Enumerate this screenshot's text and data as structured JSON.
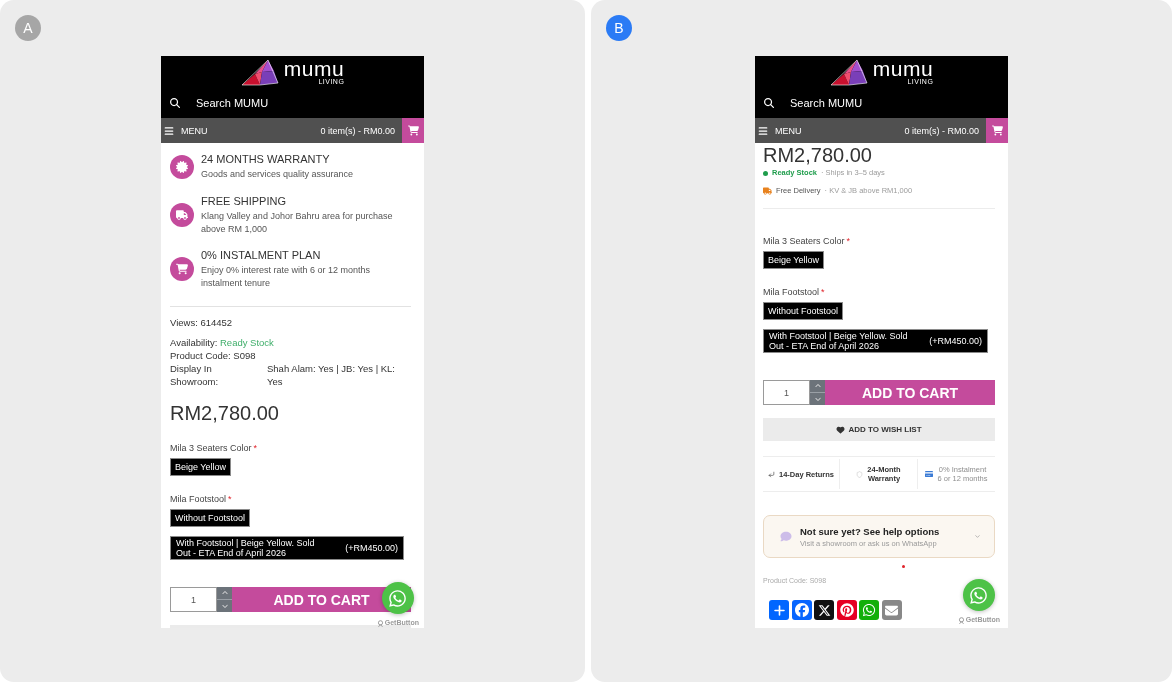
{
  "panels": [
    {
      "badge": "A",
      "color": "#a6a6a6",
      "phone": {
        "logo": {
          "name": "mumu",
          "tagline": "LIVING"
        },
        "search": {
          "placeholder": "Search MUMU"
        },
        "nav": {
          "menu": "MENU",
          "cart": "0 item(s) - RM0.00"
        },
        "content": [
          {
            "kind": "features",
            "items": [
              {
                "title": "24 MONTHS WARRANTY",
                "text": "Goods and services quality assurance"
              },
              {
                "title": "FREE SHIPPING",
                "text": "Klang Valley and Johor Bahru area for purchase above RM 1,000"
              },
              {
                "title": "0% INSTALMENT PLAN",
                "text": "Enjoy 0% interest rate with 6 or 12 months instalment tenure"
              }
            ]
          },
          {
            "kind": "details",
            "views": "Views: 614452",
            "availability": {
              "label": "Availability:",
              "value": "Ready Stock"
            },
            "code": "Product Code: S098",
            "showroom": {
              "label": "Display In Showroom:",
              "value": "Shah Alam: Yes | JB: Yes | KL: Yes"
            }
          },
          {
            "kind": "price",
            "text": "RM2,780.00"
          },
          {
            "kind": "option",
            "label": "Mila 3 Seaters Color",
            "mark": "*",
            "choices": [
              {
                "label": "Beige Yellow"
              }
            ]
          },
          {
            "kind": "option",
            "label": "Mila Footstool",
            "mark": "*",
            "choices": [
              {
                "label": "Without Footstool"
              },
              {
                "label": "With Footstool | Beige Yellow. Sold Out - ETA End of April 2026",
                "price": "(+RM450.00)"
              }
            ]
          },
          {
            "kind": "cart",
            "quantity": "1",
            "button": "ADD TO CART"
          },
          {
            "kind": "wishlist"
          }
        ],
        "chat_widget": {
          "credit": "GetButton"
        }
      }
    },
    {
      "badge": "B",
      "color": "#2b7bf5",
      "phone": {
        "logo": {
          "name": "mumu",
          "tagline": "LIVING"
        },
        "search": {
          "placeholder": "Search MUMU"
        },
        "nav": {
          "menu": "MENU",
          "cart": "0 item(s) - RM0.00"
        },
        "content": [
          {
            "kind": "price",
            "text": "RM2,780.00"
          },
          {
            "kind": "stock",
            "status": "Ready Stock",
            "note": "· Ships in 3–5 days"
          },
          {
            "kind": "delivery",
            "title": "Free Delivery",
            "note": "· KV & JB above RM1,000"
          },
          {
            "kind": "divider"
          },
          {
            "kind": "option",
            "label": "Mila 3 Seaters Color",
            "mark": "*",
            "choices": [
              {
                "label": "Beige Yellow"
              }
            ]
          },
          {
            "kind": "option",
            "label": "Mila Footstool",
            "mark": "*",
            "choices": [
              {
                "label": "Without Footstool"
              },
              {
                "label": "With Footstool | Beige Yellow. Sold Out - ETA End of April 2026",
                "price": "(+RM450.00)"
              }
            ]
          },
          {
            "kind": "cart",
            "quantity": "1",
            "button": "ADD TO CART"
          },
          {
            "kind": "wishlist",
            "label": "ADD TO WISH LIST"
          },
          {
            "kind": "perks",
            "items": [
              {
                "lines": [
                  "14-Day Returns"
                ],
                "muted": false
              },
              {
                "lines": [
                  "24-Month",
                  "Warranty"
                ],
                "muted": false
              },
              {
                "lines": [
                  "0% Instalment",
                  "6 or 12 months"
                ],
                "muted": true
              }
            ]
          },
          {
            "kind": "help",
            "title": "Not sure yet? See help options",
            "text": "Visit a showroom or ask us on WhatsApp"
          },
          {
            "kind": "code",
            "text": "Product Code: S098"
          },
          {
            "kind": "share",
            "items": [
              {
                "color": "#0166ff"
              },
              {
                "color": "#0866ff"
              },
              {
                "color": "#111111"
              },
              {
                "color": "#e60023"
              },
              {
                "color": "#12af0a"
              },
              {
                "color": "#888888"
              }
            ]
          }
        ],
        "chat_widget": {
          "credit": "GetButton"
        }
      }
    }
  ]
}
